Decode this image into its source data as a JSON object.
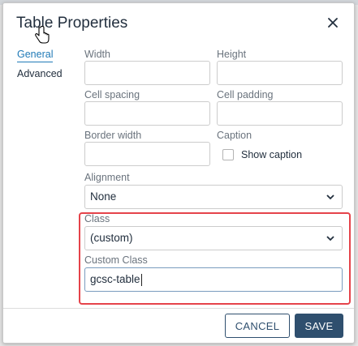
{
  "dialog": {
    "title": "Table Properties",
    "close_icon": "close-icon"
  },
  "tabs": [
    {
      "label": "General",
      "active": true
    },
    {
      "label": "Advanced",
      "active": false
    }
  ],
  "fields": {
    "width": {
      "label": "Width",
      "value": ""
    },
    "height": {
      "label": "Height",
      "value": ""
    },
    "cell_spacing": {
      "label": "Cell spacing",
      "value": ""
    },
    "cell_padding": {
      "label": "Cell padding",
      "value": ""
    },
    "border_width": {
      "label": "Border width",
      "value": ""
    },
    "caption": {
      "label": "Caption",
      "checkbox_label": "Show caption",
      "checked": false
    },
    "alignment": {
      "label": "Alignment",
      "selected": "None"
    },
    "class": {
      "label": "Class",
      "selected": "(custom)"
    },
    "custom_class": {
      "label": "Custom Class",
      "value": "gcsc-table"
    }
  },
  "footer": {
    "cancel_label": "CANCEL",
    "save_label": "SAVE"
  },
  "colors": {
    "accent": "#207ab7",
    "primary_button": "#2f4f6e",
    "highlight_border": "#e5434a"
  }
}
